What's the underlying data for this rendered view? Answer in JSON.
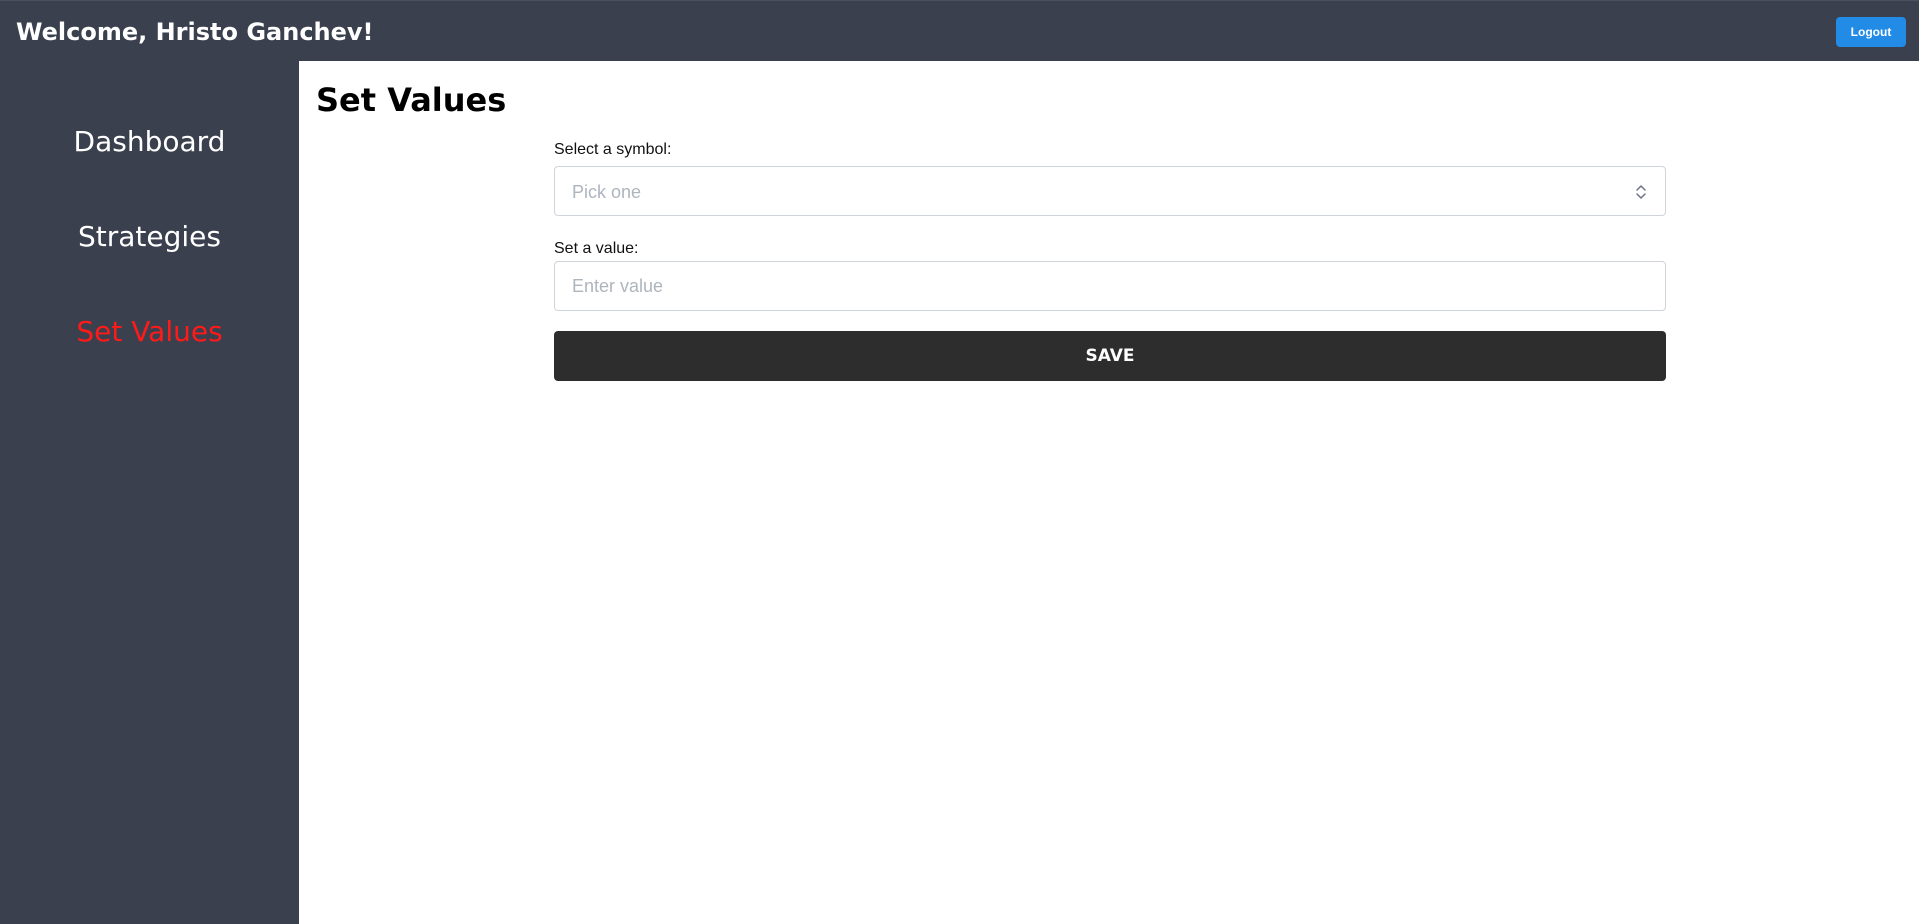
{
  "header": {
    "welcome_text": "Welcome, Hristo Ganchev!",
    "logout_label": "Logout",
    "background_color": "#3a404d",
    "logout_color": "#228be6"
  },
  "sidebar": {
    "items": [
      {
        "label": "Dashboard",
        "active": false
      },
      {
        "label": "Strategies",
        "active": false
      },
      {
        "label": "Set Values",
        "active": true
      }
    ],
    "active_color": "#ff1a1a"
  },
  "main": {
    "title": "Set Values",
    "symbol_field": {
      "label": "Select a symbol:",
      "placeholder": "Pick one",
      "icon": "chevron-updown-icon"
    },
    "value_field": {
      "label": "Set a value:",
      "placeholder": "Enter value",
      "value": ""
    },
    "save_label": "SAVE",
    "save_color": "#2d2d2d"
  }
}
